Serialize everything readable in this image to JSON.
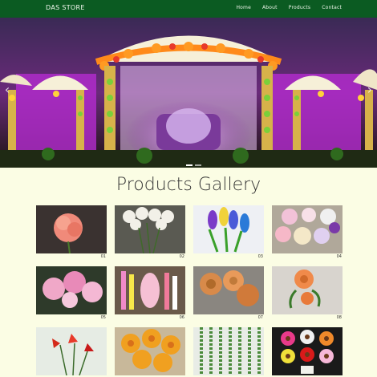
{
  "navbar": {
    "brand": "DAS STORE",
    "links": [
      "Home",
      "About",
      "Products",
      "Contact"
    ]
  },
  "gallery": {
    "title": "Products Gallery",
    "items": [
      {
        "num": "01",
        "icon": "pink-carnation-photo"
      },
      {
        "num": "02",
        "icon": "white-flowers-photo"
      },
      {
        "num": "03",
        "icon": "colorful-hyacinth-photo"
      },
      {
        "num": "04",
        "icon": "pastel-roses-photo"
      },
      {
        "num": "05",
        "icon": "pink-hydrangea-photo"
      },
      {
        "num": "06",
        "icon": "flower-garland-photo"
      },
      {
        "num": "07",
        "icon": "peach-roses-photo"
      },
      {
        "num": "08",
        "icon": "orange-rose-photo"
      },
      {
        "num": "",
        "icon": "red-lily-photo"
      },
      {
        "num": "",
        "icon": "orange-flowers-photo"
      },
      {
        "num": "",
        "icon": "green-hanging-vines-photo"
      },
      {
        "num": "",
        "icon": "gerbera-daisy-photo"
      }
    ]
  },
  "colors": {
    "navbar": "#0b5b22",
    "page_bg": "#fbfde4"
  }
}
